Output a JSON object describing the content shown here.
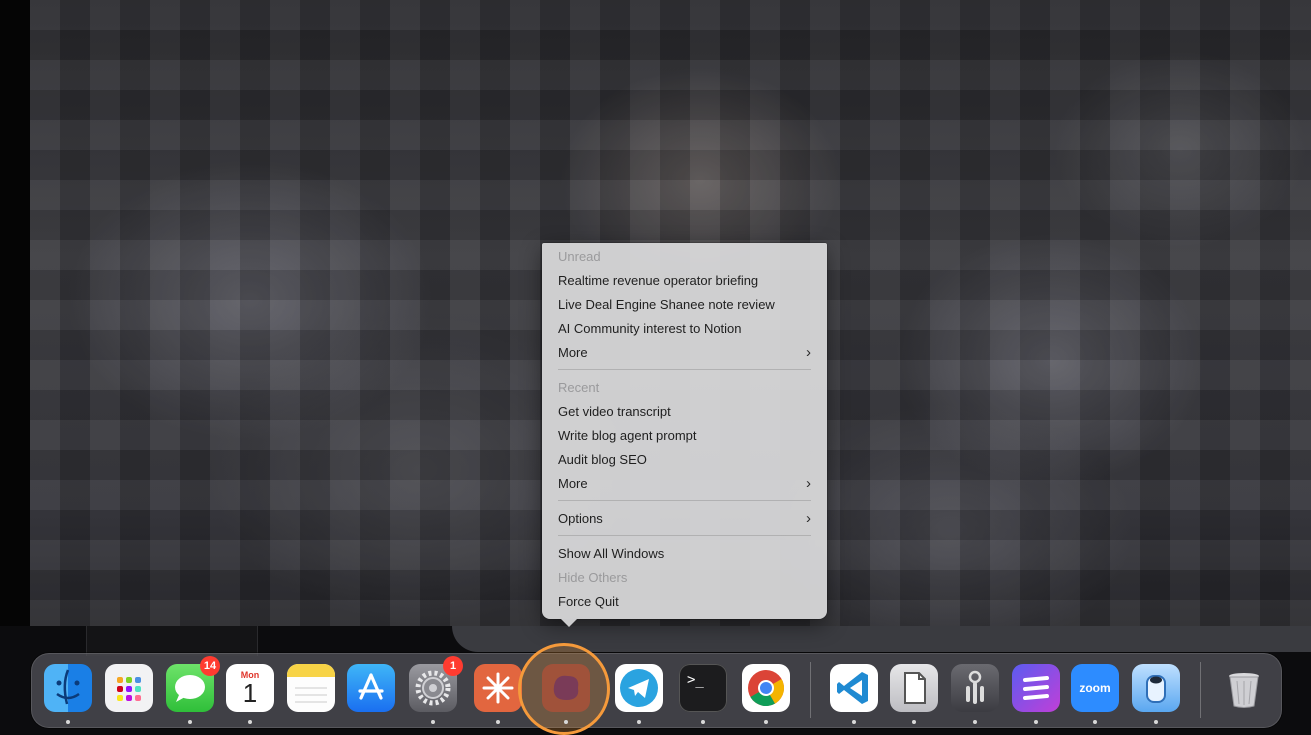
{
  "menu": {
    "unread_header": "Unread",
    "unread_items": [
      "Realtime revenue operator briefing",
      "Live Deal Engine Shanee note review",
      "AI Community interest to Notion"
    ],
    "unread_more": "More",
    "recent_header": "Recent",
    "recent_items": [
      "Get video transcript",
      "Write blog agent prompt",
      "Audit blog SEO"
    ],
    "recent_more": "More",
    "options": "Options",
    "show_all_windows": "Show All Windows",
    "hide_others": "Hide Others",
    "force_quit": "Force Quit"
  },
  "dock": {
    "calendar_month": "Mon",
    "calendar_day": "1",
    "messages_badge": "14",
    "settings_badge": "1",
    "terminal_prompt": ">_",
    "zoom_label": "zoom"
  },
  "colors": {
    "focus_ring": "#f59a3b",
    "badge": "#ff3b30"
  }
}
